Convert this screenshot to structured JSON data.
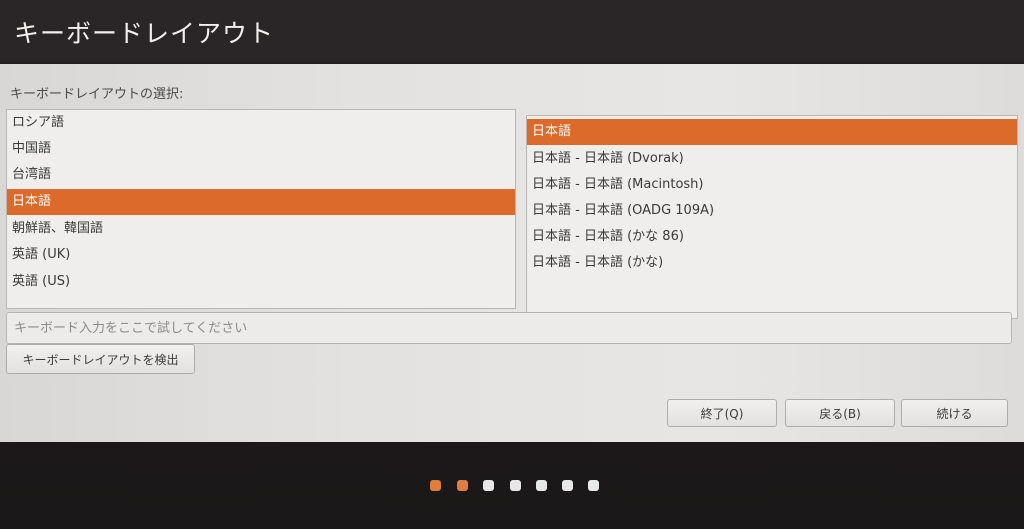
{
  "window": {
    "title": "キーボードレイアウト"
  },
  "layout_prompt": "キーボードレイアウトの選択:",
  "layouts": {
    "items": [
      {
        "label": "ロシア語",
        "selected": false
      },
      {
        "label": "中国語",
        "selected": false
      },
      {
        "label": "台湾語",
        "selected": false
      },
      {
        "label": "日本語",
        "selected": true
      },
      {
        "label": "朝鮮語、韓国語",
        "selected": false
      },
      {
        "label": "英語 (UK)",
        "selected": false
      },
      {
        "label": "英語 (US)",
        "selected": false
      }
    ]
  },
  "variants": {
    "items": [
      {
        "label": "日本語",
        "selected": true
      },
      {
        "label": "日本語 - 日本語 (Dvorak)",
        "selected": false
      },
      {
        "label": "日本語 - 日本語 (Macintosh)",
        "selected": false
      },
      {
        "label": "日本語 - 日本語 (OADG 109A)",
        "selected": false
      },
      {
        "label": "日本語 - 日本語 (かな 86)",
        "selected": false
      },
      {
        "label": "日本語 - 日本語 (かな)",
        "selected": false
      }
    ]
  },
  "test_input": {
    "value": "",
    "placeholder": "キーボード入力をここで試してください"
  },
  "buttons": {
    "detect": "キーボードレイアウトを検出",
    "quit": "終了(Q)",
    "back": "戻る(B)",
    "continue": "続ける"
  },
  "progress": {
    "total_steps": 7,
    "completed_steps": 2
  },
  "colors": {
    "selection": "#dc6a2a",
    "dot_active": "#e17d3c",
    "dot_inactive": "#e8e8e8"
  }
}
